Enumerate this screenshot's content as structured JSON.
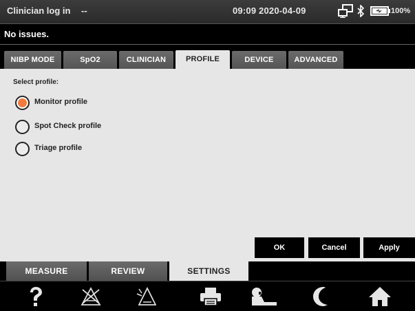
{
  "status_bar": {
    "user": "Clinician log in",
    "dash": "--",
    "datetime": "09:09 2020-04-09",
    "battery": "100%",
    "icons": [
      "network-icon",
      "bluetooth-icon",
      "battery-icon"
    ]
  },
  "message_bar": {
    "text": "No issues."
  },
  "top_tabs": [
    {
      "label": "NIBP MODE"
    },
    {
      "label": "SpO2"
    },
    {
      "label": "CLINICIAN"
    },
    {
      "label": "PROFILE",
      "active": true
    },
    {
      "label": "DEVICE"
    },
    {
      "label": "ADVANCED"
    }
  ],
  "profile": {
    "select_label": "Select profile:",
    "options": [
      {
        "label": "Monitor profile",
        "selected": true
      },
      {
        "label": "Spot Check profile",
        "selected": false
      },
      {
        "label": "Triage profile",
        "selected": false
      }
    ]
  },
  "actions": {
    "ok": "OK",
    "cancel": "Cancel",
    "apply": "Apply"
  },
  "bottom_tabs": [
    {
      "label": "MEASURE"
    },
    {
      "label": "REVIEW"
    },
    {
      "label": "SETTINGS",
      "active": true
    }
  ],
  "nav_bar": {
    "icons": [
      "help-icon",
      "alarm-silence-icon",
      "alarm-pause-icon",
      "print-icon",
      "patient-icon",
      "night-mode-icon",
      "home-icon"
    ]
  },
  "colors": {
    "accent": "#ef7a3c",
    "panel": "#e6e6e6",
    "tab": "#5e5e5e"
  }
}
